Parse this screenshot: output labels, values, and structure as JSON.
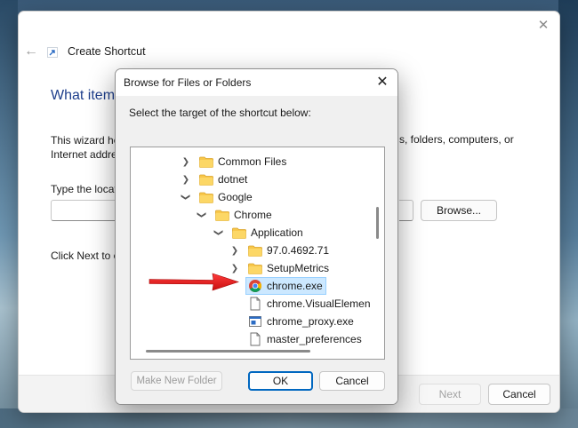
{
  "wizard": {
    "title": "Create Shortcut",
    "heading": "What item",
    "description_left": "This wizard he Internet addre",
    "description_right": "s, folders, computers, or",
    "type_label": "Type the locat",
    "browse_label": "Browse...",
    "click_next_text": "Click Next to c",
    "next_label": "Next",
    "cancel_label": "Cancel"
  },
  "browse_dialog": {
    "title": "Browse for Files or Folders",
    "prompt": "Select the target of the shortcut below:",
    "tree": [
      {
        "label": "Common Files",
        "type": "folder",
        "expander": "collapsed"
      },
      {
        "label": "dotnet",
        "type": "folder",
        "expander": "collapsed"
      },
      {
        "label": "Google",
        "type": "folder",
        "expander": "expanded"
      },
      {
        "label": "Chrome",
        "type": "folder",
        "expander": "expanded"
      },
      {
        "label": "Application",
        "type": "folder",
        "expander": "expanded"
      },
      {
        "label": "97.0.4692.71",
        "type": "folder",
        "expander": "collapsed"
      },
      {
        "label": "SetupMetrics",
        "type": "folder",
        "expander": "collapsed"
      },
      {
        "label": "chrome.exe",
        "type": "chrome-exe",
        "expander": "none",
        "selected": true
      },
      {
        "label": "chrome.VisualElemen",
        "type": "file",
        "expander": "none"
      },
      {
        "label": "chrome_proxy.exe",
        "type": "exe",
        "expander": "none"
      },
      {
        "label": "master_preferences",
        "type": "file",
        "expander": "none"
      }
    ],
    "make_new_folder_label": "Make New Folder",
    "ok_label": "OK",
    "cancel_label": "Cancel"
  },
  "colors": {
    "accent": "#0067c0",
    "selection_bg": "#cce8ff",
    "selection_border": "#99d1ff",
    "folder_yellow": "#f8c74a",
    "arrow_red": "#e01c1c",
    "heading_blue": "#1f3f8c"
  }
}
